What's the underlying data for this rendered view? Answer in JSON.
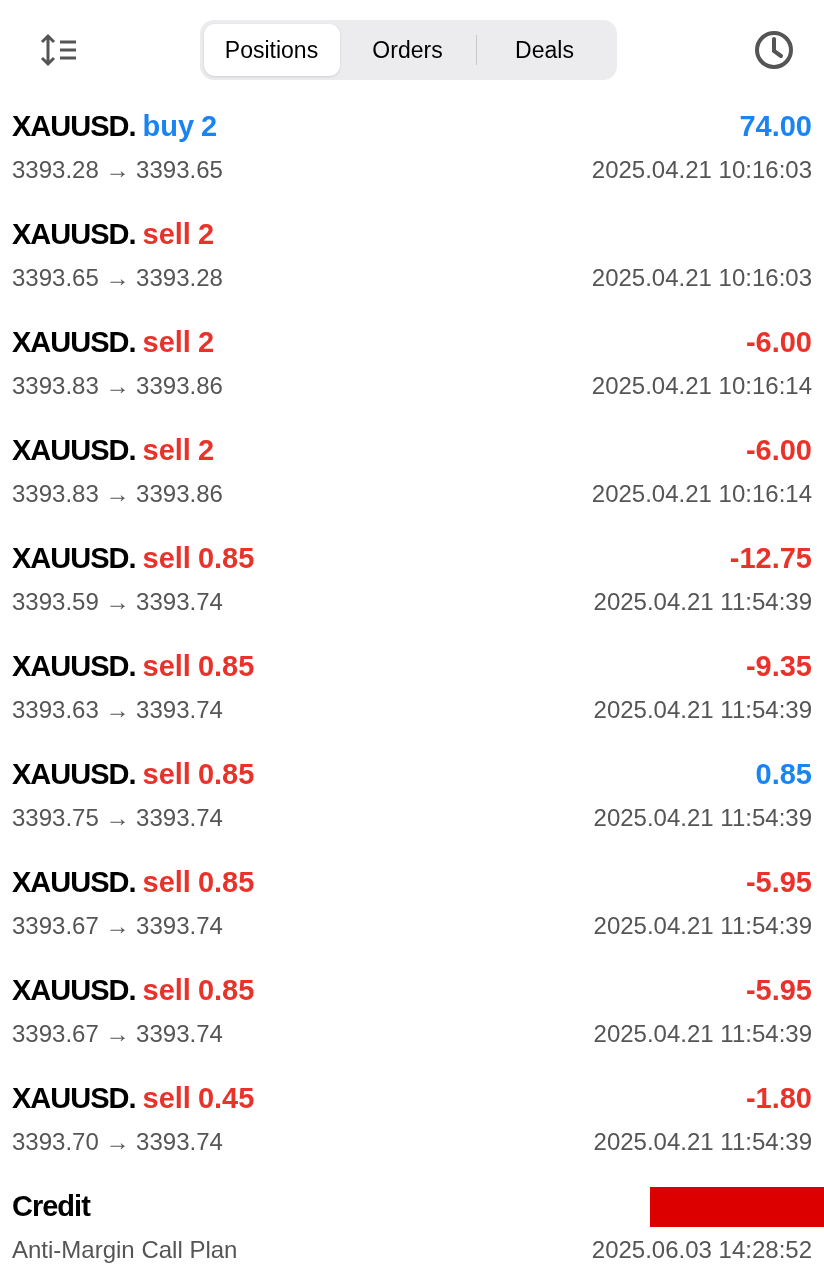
{
  "tabs": [
    {
      "label": "Positions",
      "selected": true
    },
    {
      "label": "Orders",
      "selected": false
    },
    {
      "label": "Deals",
      "selected": false
    }
  ],
  "deals": [
    {
      "kind": "buy",
      "symbol": "XAUUSD.",
      "side": "buy",
      "volume": "2",
      "profit": "74.00",
      "profit_positive": true,
      "prices": "3393.28 → 3393.65",
      "time": "2025.04.21 10:16:03"
    },
    {
      "kind": "sell",
      "symbol": "XAUUSD.",
      "side": "sell",
      "volume": "2",
      "prices": "3393.65 → 3393.28",
      "time": "2025.04.21 10:16:03"
    },
    {
      "kind": "sell",
      "symbol": "XAUUSD.",
      "side": "sell",
      "volume": "2",
      "profit": "-6.00",
      "profit_positive": false,
      "prices": "3393.83 → 3393.86",
      "time": "2025.04.21 10:16:14"
    },
    {
      "kind": "sell",
      "symbol": "XAUUSD.",
      "side": "sell",
      "volume": "2",
      "profit": "-6.00",
      "profit_positive": false,
      "prices": "3393.83 → 3393.86",
      "time": "2025.04.21 10:16:14"
    },
    {
      "kind": "sell",
      "symbol": "XAUUSD.",
      "side": "sell",
      "volume": "0.85",
      "profit": "-12.75",
      "profit_positive": false,
      "prices": "3393.59 → 3393.74",
      "time": "2025.04.21 11:54:39"
    },
    {
      "kind": "sell",
      "symbol": "XAUUSD.",
      "side": "sell",
      "volume": "0.85",
      "profit": "-9.35",
      "profit_positive": false,
      "prices": "3393.63 → 3393.74",
      "time": "2025.04.21 11:54:39"
    },
    {
      "kind": "sell",
      "symbol": "XAUUSD.",
      "side": "sell",
      "volume": "0.85",
      "profit": "0.85",
      "profit_positive": true,
      "prices": "3393.75 → 3393.74",
      "time": "2025.04.21 11:54:39"
    },
    {
      "kind": "sell",
      "symbol": "XAUUSD.",
      "side": "sell",
      "volume": "0.85",
      "profit": "-5.95",
      "profit_positive": false,
      "prices": "3393.67 → 3393.74",
      "time": "2025.04.21 11:54:39"
    },
    {
      "kind": "sell",
      "symbol": "XAUUSD.",
      "side": "sell",
      "volume": "0.85",
      "profit": "-5.95",
      "profit_positive": false,
      "prices": "3393.67 → 3393.74",
      "time": "2025.04.21 11:54:39"
    },
    {
      "kind": "sell",
      "symbol": "XAUUSD.",
      "side": "sell",
      "volume": "0.45",
      "profit": "-1.80",
      "profit_positive": false,
      "prices": "3393.70 → 3393.74",
      "time": "2025.04.21 11:54:39"
    },
    {
      "kind": "credit",
      "symbol": "Credit",
      "redacted": true,
      "prices": "Anti-Margin Call Plan",
      "time": "2025.06.03 14:28:52"
    }
  ]
}
